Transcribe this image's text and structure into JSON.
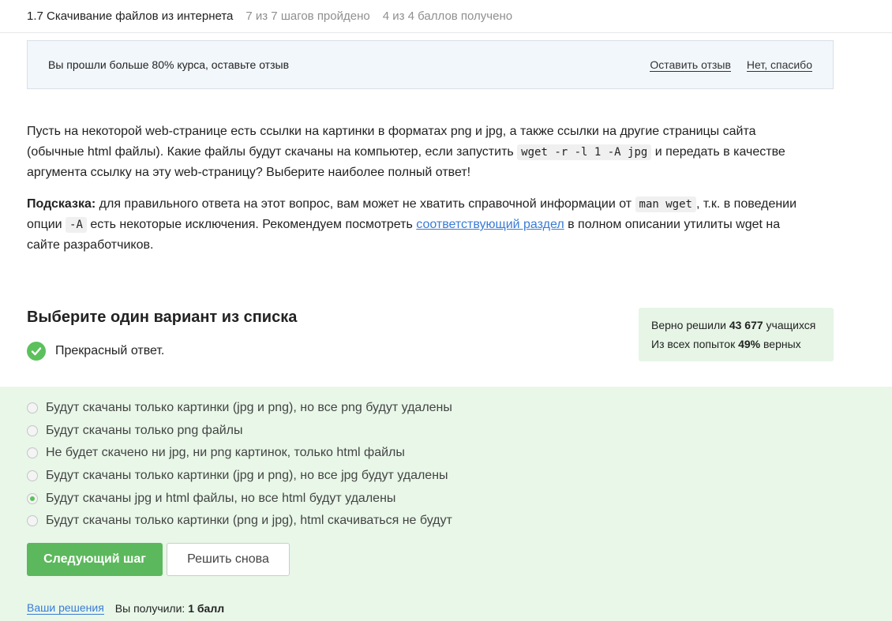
{
  "header": {
    "lesson_title": "1.7 Скачивание файлов из интернета",
    "steps_progress": "7 из 7 шагов пройдено",
    "score_progress": "4 из 4 баллов  получено"
  },
  "review_banner": {
    "message": "Вы прошли больше 80% курса, оставьте отзыв",
    "leave_review": "Оставить отзыв",
    "no_thanks": "Нет, спасибо"
  },
  "question": {
    "p1_a": "Пусть на некоторой web-странице есть ссылки на картинки в форматах png и jpg, а также ссылки на другие страницы сайта (обычные html файлы). Какие файлы будут скачаны на компьютер, если запустить ",
    "p1_code": "wget -r -l 1 -A jpg",
    "p1_b": " и передать в качестве аргумента ссылку на эту web-страницу? Выберите наиболее полный ответ!",
    "hint_label": "Подсказка:",
    "hint_a": " для правильного ответа на этот вопрос, вам может не хватить справочной информации от ",
    "hint_code1": "man wget",
    "hint_b": ", т.к. в поведении опции ",
    "hint_code2": "-A",
    "hint_c": " есть некоторые исключения. Рекомендуем посмотреть ",
    "hint_link": "соответствующий раздел",
    "hint_d": " в полном описании утилиты wget на сайте разработчиков."
  },
  "quiz": {
    "title": "Выберите один вариант из списка",
    "feedback": "Прекрасный ответ.",
    "stats": {
      "solved_prefix": "Верно решили ",
      "solved_count": "43 677",
      "solved_suffix": " учащихся",
      "attempts_prefix": "Из всех попыток ",
      "attempts_percent": "49%",
      "attempts_suffix": " верных"
    },
    "options": [
      {
        "label": "Будут скачаны только картинки (jpg и png), но все png будут удалены",
        "selected": false
      },
      {
        "label": "Будут скачаны только png файлы",
        "selected": false
      },
      {
        "label": "Не будет скачено ни jpg, ни png картинок, только html файлы",
        "selected": false
      },
      {
        "label": "Будут скачаны только картинки (jpg и png), но все jpg будут удалены",
        "selected": false
      },
      {
        "label": "Будут скачаны jpg и html файлы, но все html будут удалены",
        "selected": true
      },
      {
        "label": "Будут скачаны только картинки (png и jpg), html скачиваться не будут",
        "selected": false
      }
    ],
    "next_button": "Следующий шаг",
    "retry_button": "Решить снова",
    "solutions_link": "Ваши решения",
    "result_prefix": "Вы получили: ",
    "result_value": "1 балл"
  },
  "colors": {
    "accent_green": "#5cb85c",
    "answer_bg": "#e8f7e8",
    "link_blue": "#3a7bd5"
  }
}
